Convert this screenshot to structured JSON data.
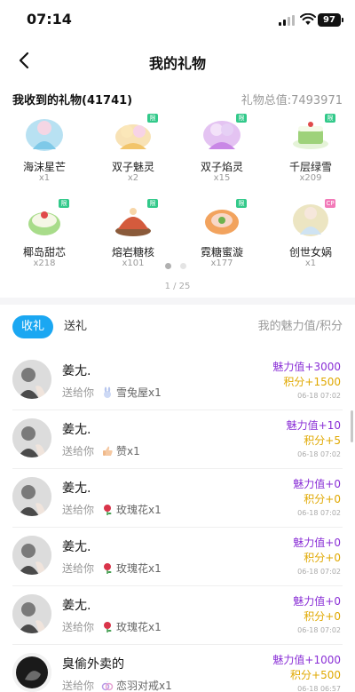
{
  "status_bar": {
    "time": "07:14",
    "battery": "97"
  },
  "nav": {
    "title": "我的礼物"
  },
  "received": {
    "title": "我收到的礼物(41741)",
    "total": "礼物总值:7493971"
  },
  "gifts": [
    {
      "name": "海沫星芒",
      "count": "x1",
      "color": "#7ec9e8",
      "tag": "",
      "tag_color": ""
    },
    {
      "name": "双子魅灵",
      "count": "x2",
      "color": "#f2c56b",
      "tag": "限",
      "tag_color": "#32c98a"
    },
    {
      "name": "双子焰灵",
      "count": "x15",
      "color": "#c987e6",
      "tag": "限",
      "tag_color": "#32c98a"
    },
    {
      "name": "千层绿雪",
      "count": "x209",
      "color": "#9ed27a",
      "tag": "限",
      "tag_color": "#32c98a"
    },
    {
      "name": "椰岛甜芯",
      "count": "x218",
      "color": "#a8dc8a",
      "tag": "限",
      "tag_color": "#32c98a"
    },
    {
      "name": "熔岩糖核",
      "count": "x101",
      "color": "#d45b3d",
      "tag": "限",
      "tag_color": "#32c98a"
    },
    {
      "name": "霓糖蜜漩",
      "count": "x177",
      "color": "#f2a35e",
      "tag": "限",
      "tag_color": "#32c98a"
    },
    {
      "name": "创世女娲",
      "count": "x1",
      "color": "#e0d49a",
      "tag": "CP",
      "tag_color": "#f27ab8"
    }
  ],
  "pager": {
    "text": "1 / 25"
  },
  "tabs": {
    "received": "收礼",
    "sent": "送礼",
    "right": "我的魅力值/积分"
  },
  "records": [
    {
      "name": "姜尢.",
      "prefix": "送给你",
      "gift": "雪兔屋x1",
      "gift_icon": "snow-bunny-icon",
      "charm": "魅力值+3000",
      "points": "积分+1500",
      "time": "06-18 07:02"
    },
    {
      "name": "姜尢.",
      "prefix": "送给你",
      "gift": "赞x1",
      "gift_icon": "thumbs-up-icon",
      "charm": "魅力值+10",
      "points": "积分+5",
      "time": "06-18 07:02"
    },
    {
      "name": "姜尢.",
      "prefix": "送给你",
      "gift": "玫瑰花x1",
      "gift_icon": "rose-icon",
      "charm": "魅力值+0",
      "points": "积分+0",
      "time": "06-18 07:02"
    },
    {
      "name": "姜尢.",
      "prefix": "送给你",
      "gift": "玫瑰花x1",
      "gift_icon": "rose-icon",
      "charm": "魅力值+0",
      "points": "积分+0",
      "time": "06-18 07:02"
    },
    {
      "name": "姜尢.",
      "prefix": "送给你",
      "gift": "玫瑰花x1",
      "gift_icon": "rose-icon",
      "charm": "魅力值+0",
      "points": "积分+0",
      "time": "06-18 07:02"
    },
    {
      "name": "臭偷外卖的",
      "prefix": "送给你",
      "gift": "恋羽对戒x1",
      "gift_icon": "ring-icon",
      "charm": "魅力值+1000",
      "points": "积分+500",
      "time": "06-18 06:57"
    }
  ],
  "colors": {
    "accent": "#1aa7f2",
    "charm": "#8a2fd6",
    "points": "#e0a800"
  }
}
